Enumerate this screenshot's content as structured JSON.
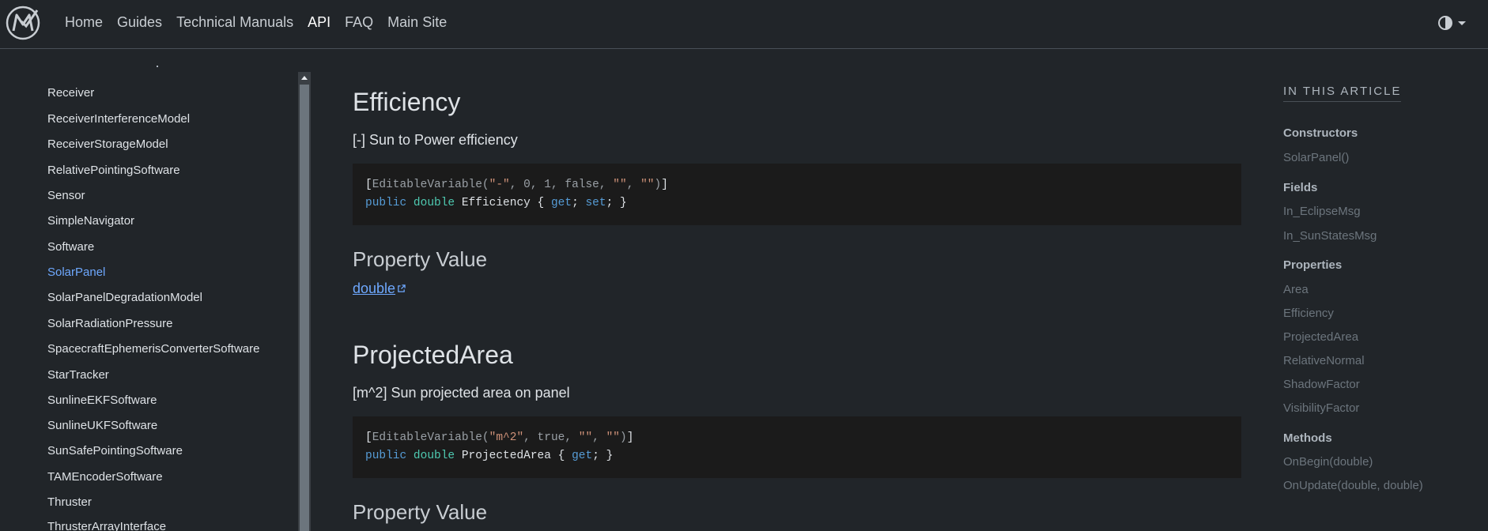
{
  "nav": {
    "items": [
      "Home",
      "Guides",
      "Technical Manuals",
      "API",
      "FAQ",
      "Main Site"
    ],
    "active": "API"
  },
  "sidebar": {
    "items": [
      "Receiver",
      "ReceiverInterferenceModel",
      "ReceiverStorageModel",
      "RelativePointingSoftware",
      "Sensor",
      "SimpleNavigator",
      "Software",
      "SolarPanel",
      "SolarPanelDegradationModel",
      "SolarRadiationPressure",
      "SpacecraftEphemerisConverterSoftware",
      "StarTracker",
      "SunlineEKFSoftware",
      "SunlineUKFSoftware",
      "SunSafePointingSoftware",
      "TAMEncoderSoftware",
      "Thruster",
      "ThrusterArrayInterface"
    ],
    "active": "SolarPanel"
  },
  "article": {
    "efficiency": {
      "title": "Efficiency",
      "summary": "[-] Sun to Power efficiency",
      "property_value_heading": "Property Value",
      "type": "double"
    },
    "projected_area": {
      "title": "ProjectedArea",
      "summary": "[m^2] Sun projected area on panel",
      "property_value_heading": "Property Value"
    }
  },
  "in_this_article": {
    "title": "IN THIS ARTICLE",
    "constructors_heading": "Constructors",
    "constructors": [
      "SolarPanel()"
    ],
    "fields_heading": "Fields",
    "fields": [
      "In_EclipseMsg",
      "In_SunStatesMsg"
    ],
    "properties_heading": "Properties",
    "properties": [
      "Area",
      "Efficiency",
      "ProjectedArea",
      "RelativeNormal",
      "ShadowFactor",
      "VisibilityFactor"
    ],
    "methods_heading": "Methods",
    "methods": [
      "OnBegin(double)",
      "OnUpdate(double, double)"
    ]
  },
  "icons": {
    "logo": "mk-logo-icon",
    "theme": "contrast-half-circle-icon",
    "external_link": "external-link-icon"
  },
  "colors": {
    "background": "#212529",
    "link": "#6ea8fe",
    "code_bg": "#1b1b1b"
  }
}
